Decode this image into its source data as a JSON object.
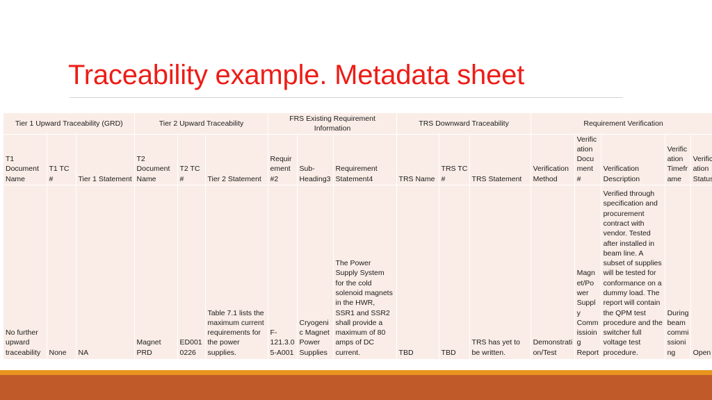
{
  "slide": {
    "title": "Traceability example. Metadata sheet",
    "title_color": "#ED1C16",
    "accent_stripe_color": "#E8941F",
    "accent_band_color": "#C05A28",
    "table_cell_color": "#FAEDE7"
  },
  "table": {
    "group_headers": [
      "Tier 1 Upward Traceability (GRD)",
      "Tier 2 Upward Traceability",
      "FRS Existing Requirement Information",
      "TRS Downward Traceability",
      "Requirement Verification"
    ],
    "columns": [
      "T1 Document Name",
      "T1 TC #",
      "Tier 1 Statement",
      "T2 Document Name",
      "T2 TC #",
      "Tier 2 Statement",
      "Requirement #2",
      "Sub-Heading3",
      "Requirement Statement4",
      "TRS Name",
      "TRS TC #",
      "TRS Statement",
      "Verification Method",
      "Verification Document #",
      "Verification Description",
      "Verification Timeframe",
      "Verification Status"
    ],
    "rows": [
      {
        "t1_document_name": "No further upward traceability",
        "t1_tc": "None",
        "tier1_statement": "NA",
        "t2_document_name": "Magnet PRD",
        "t2_tc": "ED0010226",
        "tier2_statement": "Table 7.1 lists the maximum current requirements for the power supplies.",
        "requirement_num": "F-121.3.05-A001",
        "sub_heading": "Cryogenic Magnet Power Supplies",
        "requirement_statement": "The Power Supply System for the cold solenoid magnets in the HWR, SSR1 and SSR2 shall provide a maximum of 80 amps of DC current.",
        "trs_name": "TBD",
        "trs_tc": "TBD",
        "trs_statement": "TRS has yet to be written.",
        "verification_method": "Demonstration/Test",
        "verification_document": "Magnet/Power Supply Commissioing Report",
        "verification_description": "Verified through specification and procurement contract with vendor.  Tested after installed in beam line.  A subset of supplies will be tested for conformance on a dummy load.  The report will contain the QPM test procedure and the switcher full voltage test procedure.",
        "verification_timeframe": "During beam commissioning",
        "verification_status": "Open"
      }
    ]
  }
}
